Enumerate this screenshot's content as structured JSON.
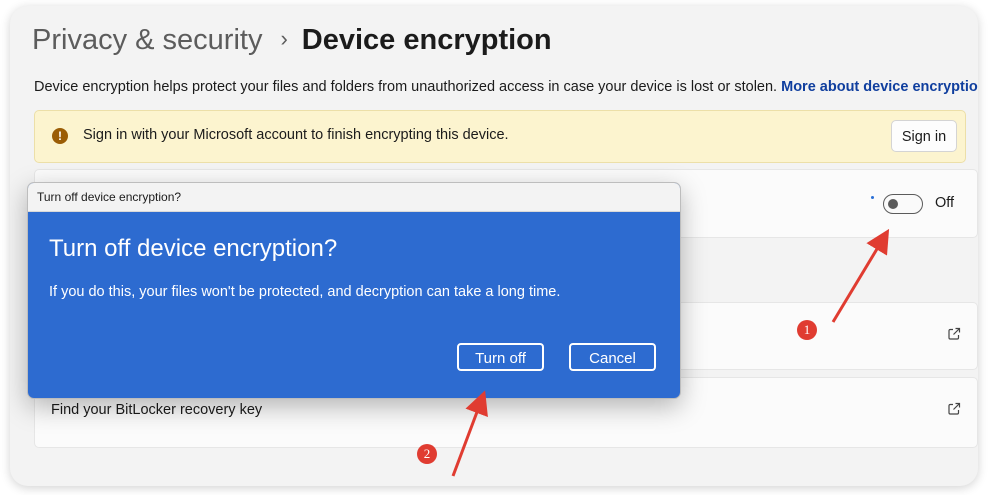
{
  "breadcrumb": {
    "parent": "Privacy & security",
    "separator": "›",
    "current": "Device encryption"
  },
  "description": {
    "text": "Device encryption helps protect your files and folders from unauthorized access in case your device is lost or stolen. ",
    "link": "More about device encryption"
  },
  "banner": {
    "icon": "warning-icon",
    "text": "Sign in with your Microsoft account to finish encrypting this device.",
    "button": "Sign in"
  },
  "encryption_setting": {
    "toggle_state": "Off",
    "toggle_on": false
  },
  "cards": [
    {
      "label": "",
      "icon": "external-link-icon"
    },
    {
      "label": "Find your BitLocker recovery key",
      "icon": "external-link-icon"
    }
  ],
  "dialog": {
    "window_title": "Turn off device encryption?",
    "heading": "Turn off device encryption?",
    "body": "If you do this, your files won't be protected, and decryption can take a long time.",
    "primary_button": "Turn off",
    "secondary_button": "Cancel"
  },
  "annotations": [
    {
      "number": "1",
      "target": "encryption-toggle"
    },
    {
      "number": "2",
      "target": "turn-off-button"
    }
  ],
  "colors": {
    "accent": "#2d6bd0",
    "link": "#0f3e9e",
    "banner_bg": "#fcf4cf",
    "annotation_red": "#e03c31"
  }
}
